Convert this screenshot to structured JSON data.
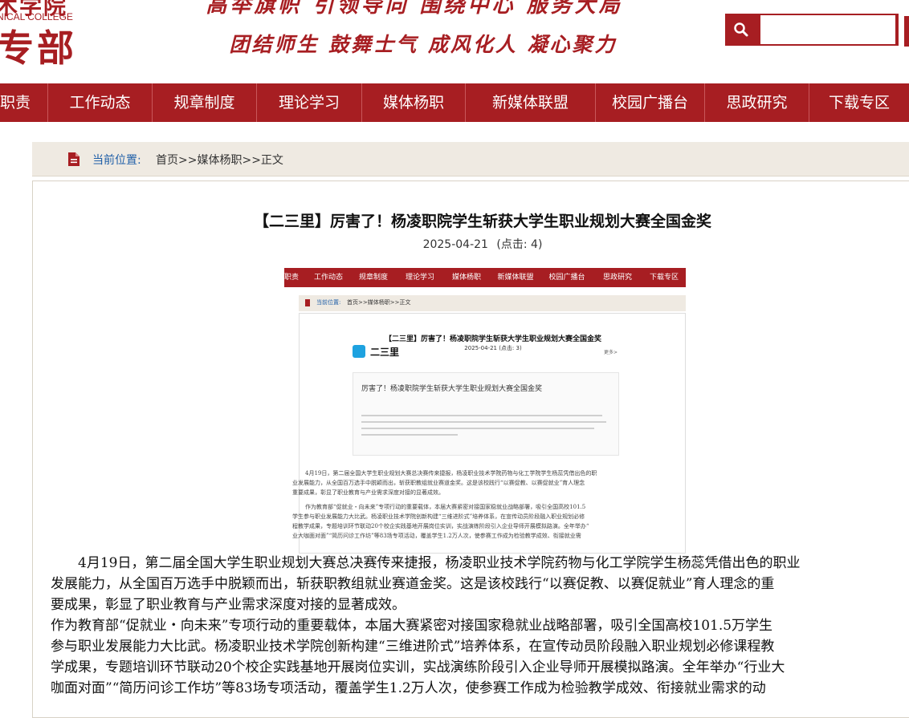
{
  "header": {
    "logo_top": "术学院",
    "logo_en": "NICAL COLLEGE",
    "logo_big": "专部",
    "slogan_line1": "高举旗帜 引领导向 围绕中心 服务大局",
    "slogan_line2": "团结师生 鼓舞士气 成风化人 凝心聚力",
    "search_placeholder": ""
  },
  "nav": {
    "items": [
      {
        "label": "职责"
      },
      {
        "label": "工作动态"
      },
      {
        "label": "规章制度"
      },
      {
        "label": "理论学习"
      },
      {
        "label": "媒体杨职"
      },
      {
        "label": "新媒体联盟"
      },
      {
        "label": "校园广播台"
      },
      {
        "label": "思政研究"
      },
      {
        "label": "下载专区"
      }
    ]
  },
  "breadcrumb": {
    "label": "当前位置:",
    "path": "首页>>媒体杨职>>正文"
  },
  "article": {
    "title": "【二三里】厉害了！杨凌职院学生斩获大学生职业规划大赛全国金奖",
    "date": "2025-04-21",
    "clicks": "(点击:  4)",
    "embedded": {
      "nav": [
        "职责",
        "工作动态",
        "规章制度",
        "理论学习",
        "媒体杨职",
        "新媒体联盟",
        "校园广播台",
        "思政研究",
        "下载专区"
      ],
      "bc_label": "当前位置:",
      "bc_path": "首页>>媒体杨职>>正文",
      "title": "【二三里】厉害了！杨凌职院学生斩获大学生职业规划大赛全国金奖",
      "meta": "2025-04-21    (点击:  3)",
      "account": "二三里",
      "more": "更多>",
      "card_title": "厉害了！杨凌职院学生斩获大学生职业规划大赛全国金奖",
      "lines": [
        "4月19日，第二届全国大学生职业规划大赛总决赛传来捷报，杨凌职业技术学院药物与化工学院学生杨蕊凭借出色的职",
        "业发展能力，从全国百万选手中脱颖而出，斩获职教组就业赛道金奖。这是该校践行“以赛促教、以赛促就业”育人理念",
        "重要成果，彰显了职业教育与产业需求深度对接的显著成效。",
        "作为教育部“促就业・向未来”专项行动的重要载体，本届大赛紧密对接国家稳就业战略部署，吸引全国高校101.5",
        "学生参与职业发展能力大比武。杨凌职业技术学院创新构建“三维进阶式”培养体系，在宣传动员阶段融入职业规划必修",
        "程教学成果，专题培训环节联动20个校企实践基地开展岗位实训，实战演练阶段引入企业导师开展模拟路演。全年举办“",
        "业大咖面对面”“简历问诊工作坊”等83场专项活动，覆盖学生1.2万人次，使参赛工作成为检验教学成效、衔接就业需"
      ]
    },
    "paragraphs": [
      "4月19日，第二届全国大学生职业规划大赛总决赛传来捷报，杨凌职业技术学院药物与化工学院学生杨蕊凭借出色的职业",
      "发展能力，从全国百万选手中脱颖而出，斩获职教组就业赛道金奖。这是该校践行“以赛促教、以赛促就业”育人理念的重",
      "要成果，彰显了职业教育与产业需求深度对接的显著成效。",
      "作为教育部“促就业・向未来”专项行动的重要载体，本届大赛紧密对接国家稳就业战略部署，吸引全国高校101.5万学生",
      "参与职业发展能力大比武。杨凌职业技术学院创新构建“三维进阶式”培养体系，在宣传动员阶段融入职业规划必修课程教",
      "学成果，专题培训环节联动20个校企实践基地开展岗位实训，实战演练阶段引入企业导师开展模拟路演。全年举办“行业大",
      "咖面对面”“简历问诊工作坊”等83场专项活动，覆盖学生1.2万人次，使参赛工作成为检验教学成效、衔接就业需求的动"
    ]
  },
  "colors": {
    "brand_red": "#a71e22",
    "breadcrumb_bg": "#efeae2",
    "link_blue": "#1f5fa8"
  },
  "icons": {
    "search": "search-icon",
    "document": "document-icon"
  }
}
